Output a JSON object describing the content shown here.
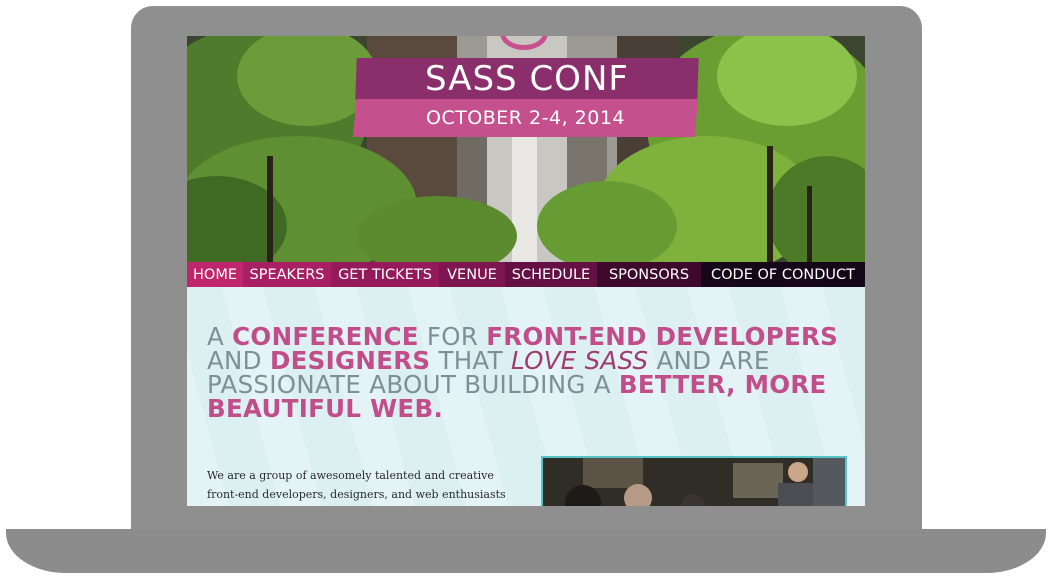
{
  "site": {
    "title": "SASS CONF",
    "date": "OCTOBER 2-4, 2014"
  },
  "nav": [
    {
      "label": "HOME",
      "color": "#c0266e"
    },
    {
      "label": "SPEAKERS",
      "color": "#a81f64"
    },
    {
      "label": "GET TICKETS",
      "color": "#941a5b"
    },
    {
      "label": "VENUE",
      "color": "#7d1550"
    },
    {
      "label": "SCHEDULE",
      "color": "#641044"
    },
    {
      "label": "SPONSORS",
      "color": "#3d0a2e"
    },
    {
      "label": "CODE OF CONDUCT",
      "color": "#15061a"
    }
  ],
  "tagline": {
    "w1": "A ",
    "w2": "CONFERENCE",
    "w3": " FOR ",
    "w4": "FRONT-END DEVELOPERS",
    "w5": " AND ",
    "w6": "DESIGNERS",
    "w7": " THAT ",
    "w8": "LOVE SASS",
    "w9": " AND ARE PASSIONATE ABOUT BUILDING A ",
    "w10": "BETTER, MORE BEAUTIFUL WEB."
  },
  "about": {
    "text": "We are a group of awesomely talented and creative front-end developers, designers, and web enthusiasts coming together for three days of talks, workshops, and panels on"
  },
  "colors": {
    "accent": "#c14d8b",
    "banner_dark": "#8a2f6c",
    "photo_border": "#56c3c6"
  }
}
